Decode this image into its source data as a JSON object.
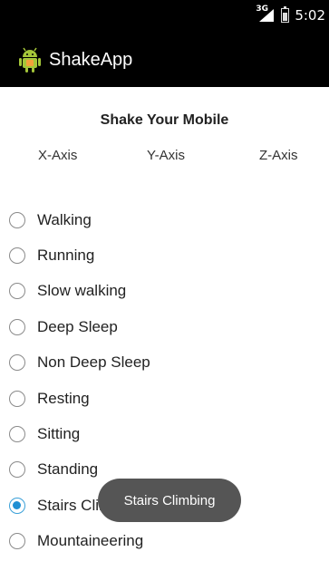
{
  "status_bar": {
    "network": "3G",
    "time": "5:02"
  },
  "action_bar": {
    "app_title": "ShakeApp",
    "icon": "android-robot-icon"
  },
  "main": {
    "heading": "Shake Your Mobile",
    "axes": [
      "X-Axis",
      "Y-Axis",
      "Z-Axis"
    ],
    "activities": [
      {
        "label": "Walking",
        "checked": false
      },
      {
        "label": "Running",
        "checked": false
      },
      {
        "label": "Slow walking",
        "checked": false
      },
      {
        "label": "Deep Sleep",
        "checked": false
      },
      {
        "label": "Non Deep Sleep",
        "checked": false
      },
      {
        "label": "Resting",
        "checked": false
      },
      {
        "label": "Sitting",
        "checked": false
      },
      {
        "label": "Standing",
        "checked": false
      },
      {
        "label": "Stairs Climbing",
        "checked": true
      },
      {
        "label": "Mountaineering",
        "checked": false
      }
    ]
  },
  "toast": {
    "message": "Stairs Climbing"
  },
  "colors": {
    "radio_checked": "#1f8fd3",
    "action_bar": "#000000",
    "toast_bg": "#555555"
  }
}
